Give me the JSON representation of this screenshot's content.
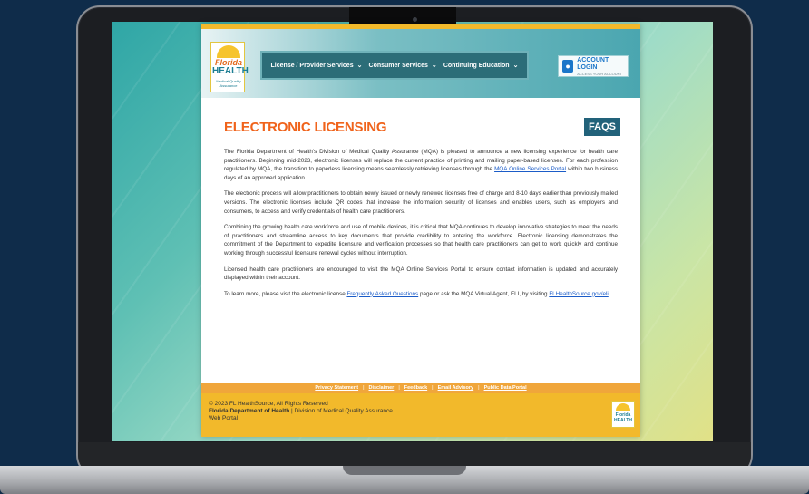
{
  "header": {
    "logo": {
      "line1": "Florida",
      "line2": "HEALTH",
      "line3": "Medical Quality Assurance"
    },
    "nav": [
      {
        "label": "License / Provider Services"
      },
      {
        "label": "Consumer Services"
      },
      {
        "label": "Continuing Education"
      }
    ],
    "account": {
      "title": "ACCOUNT LOGIN",
      "subtitle": "ACCESS YOUR ACCOUNT"
    }
  },
  "main": {
    "title": "ELECTRONIC LICENSING",
    "faqs_label": "FAQS",
    "p1_a": "The Florida Department of Health's Division of Medical Quality Assurance (MQA) is pleased to announce a new licensing experience for health care practitioners. Beginning mid-2023, electronic licenses will replace the current practice of printing and mailing paper-based licenses. For each profession regulated by MQA, the transition to paperless licensing means seamlessly retrieving licenses through the ",
    "p1_link": "MQA Online Services Portal",
    "p1_b": " within two business days of an approved application.",
    "p2": "The electronic process will allow practitioners to obtain newly issued or newly renewed licenses free of charge and 8-10 days earlier than previously mailed versions. The electronic licenses include QR codes that increase the information security of licenses and enables users, such as employers and consumers,  to access and verify credentials of health care practitioners.",
    "p3": "Combining the growing health care workforce and use of mobile devices, it is critical that MQA continues to develop innovative strategies to meet the needs of practitioners and streamline access to key documents that provide credibility to entering the workforce. Electronic licensing demonstrates the commitment of the Department to expedite licensure and verification processes so that health care practitioners can get to work quickly and continue working through successful licensure renewal cycles without interruption.",
    "p4": "Licensed health care practitioners are encouraged to visit the MQA Online Services Portal to ensure contact information is updated and accurately displayed within their account.",
    "p5_a": "To learn more, please visit the electronic license ",
    "p5_link1": "Frequently Asked Questions",
    "p5_b": " page or ask the MQA Virtual Agent, ELI, by visiting ",
    "p5_link2": "FLHealthSource.gov/eli",
    "p5_c": "."
  },
  "footer": {
    "links": [
      {
        "label": "Privacy Statement"
      },
      {
        "label": "Disclaimer"
      },
      {
        "label": "Feedback"
      },
      {
        "label": "Email Advisory"
      },
      {
        "label": "Public Data Portal"
      }
    ],
    "separator": "|",
    "copyright": "© 2023 FL HealthSource, All Rights Reserved",
    "dept_bold": "Florida Department of Health",
    "dept_rest": " | Division of Medical Quality Assurance",
    "portal": "Web Portal",
    "logo_text": "Florida HEALTH"
  },
  "colors": {
    "accent_orange": "#f0631b",
    "brand_teal": "#22627a",
    "gold": "#f2b92b",
    "link_blue": "#1b5cc8"
  }
}
